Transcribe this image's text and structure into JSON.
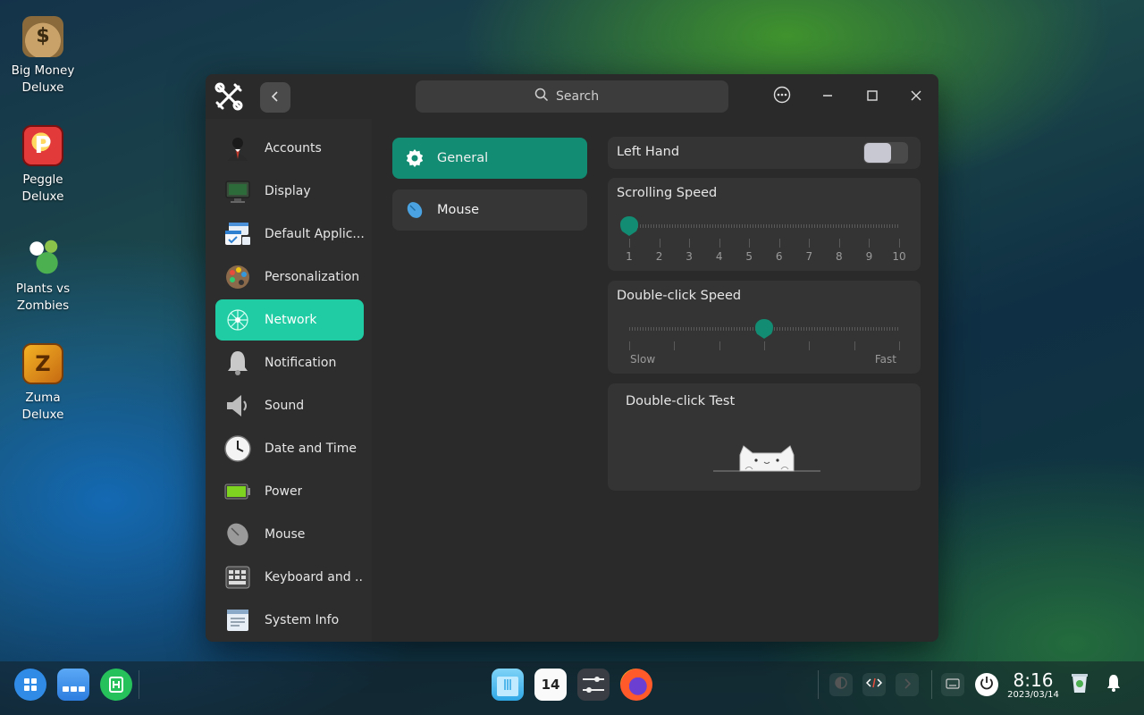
{
  "desktop": {
    "icons": [
      {
        "label": "Big Money\nDeluxe"
      },
      {
        "label": "Peggle\nDeluxe"
      },
      {
        "label": "Plants vs\nZombies"
      },
      {
        "label": "Zuma\nDeluxe"
      }
    ]
  },
  "window": {
    "search": {
      "placeholder": "Search"
    },
    "sidebar": {
      "items": [
        {
          "label": "Accounts",
          "icon": "accounts-icon"
        },
        {
          "label": "Display",
          "icon": "display-icon"
        },
        {
          "label": "Default Applic...",
          "icon": "default-apps-icon"
        },
        {
          "label": "Personalization",
          "icon": "palette-icon"
        },
        {
          "label": "Network",
          "icon": "network-icon",
          "active": true
        },
        {
          "label": "Notification",
          "icon": "bell-icon"
        },
        {
          "label": "Sound",
          "icon": "speaker-icon"
        },
        {
          "label": "Date and Time",
          "icon": "clock-icon"
        },
        {
          "label": "Power",
          "icon": "battery-icon"
        },
        {
          "label": "Mouse",
          "icon": "mouse-icon"
        },
        {
          "label": "Keyboard and ...",
          "icon": "keyboard-icon"
        },
        {
          "label": "System Info",
          "icon": "system-info-icon"
        }
      ]
    },
    "subnav": {
      "items": [
        {
          "label": "General",
          "icon": "gear-icon",
          "active": true
        },
        {
          "label": "Mouse",
          "icon": "mouse-icon"
        }
      ]
    },
    "settings": {
      "left_hand": {
        "label": "Left Hand",
        "enabled": false
      },
      "scrolling_speed": {
        "label": "Scrolling Speed",
        "value": 1,
        "ticks": [
          "1",
          "2",
          "3",
          "4",
          "5",
          "6",
          "7",
          "8",
          "9",
          "10"
        ]
      },
      "double_click_speed": {
        "label": "Double-click Speed",
        "value_fraction": 0.5,
        "min_label": "Slow",
        "max_label": "Fast"
      },
      "double_click_test": {
        "label": "Double-click Test"
      }
    }
  },
  "taskbar": {
    "clock": {
      "time": "8:16",
      "date": "2023/03/14"
    },
    "calendar_day": "14"
  },
  "colors": {
    "accent": "#20cca3",
    "accent_dark": "#128c72",
    "window_bg": "#2a2a2a"
  }
}
